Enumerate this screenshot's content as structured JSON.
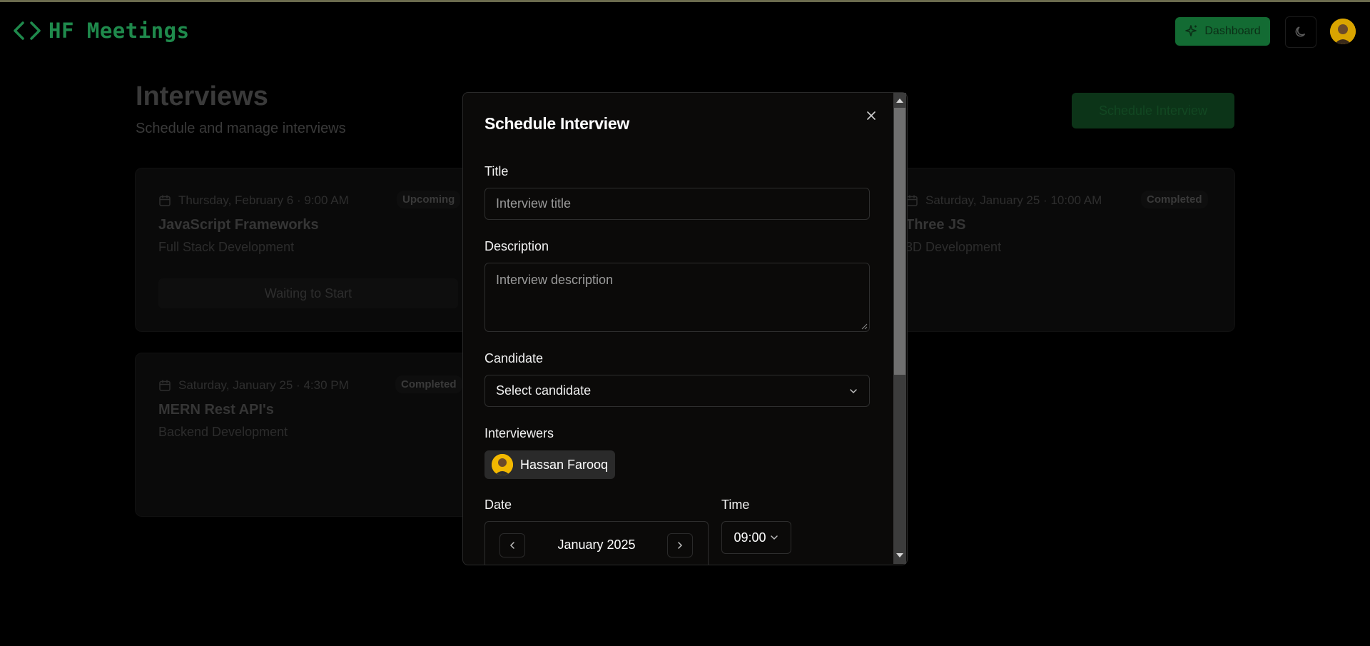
{
  "header": {
    "logo_text": "HF Meetings",
    "dashboard_label": "Dashboard"
  },
  "main": {
    "title": "Interviews",
    "subtitle": "Schedule and manage interviews",
    "schedule_button": "Schedule Interview"
  },
  "cards": [
    {
      "date": "Thursday, February 6 · 9:00 AM",
      "badge": "Upcoming",
      "title": "JavaScript Frameworks",
      "subtitle": "Full Stack Development",
      "action": "Waiting to Start"
    },
    {
      "date": "Saturday, January 25 · 10:00 AM",
      "badge": "Completed",
      "title": "Three JS",
      "subtitle": "3D Development"
    },
    {
      "date": "Saturday, January 25 · 4:30 PM",
      "badge": "Completed",
      "title": "MERN Rest API's",
      "subtitle": "Backend Development"
    }
  ],
  "modal": {
    "title": "Schedule Interview",
    "title_label": "Title",
    "title_placeholder": "Interview title",
    "description_label": "Description",
    "description_placeholder": "Interview description",
    "candidate_label": "Candidate",
    "candidate_value": "Select candidate",
    "interviewers_label": "Interviewers",
    "interviewer_name": "Hassan Farooq",
    "date_label": "Date",
    "calendar_month": "January 2025",
    "time_label": "Time",
    "time_value": "09:00"
  },
  "colors": {
    "accent": "#136b33",
    "background": "#000000",
    "modal_bg": "#0b0a09"
  }
}
